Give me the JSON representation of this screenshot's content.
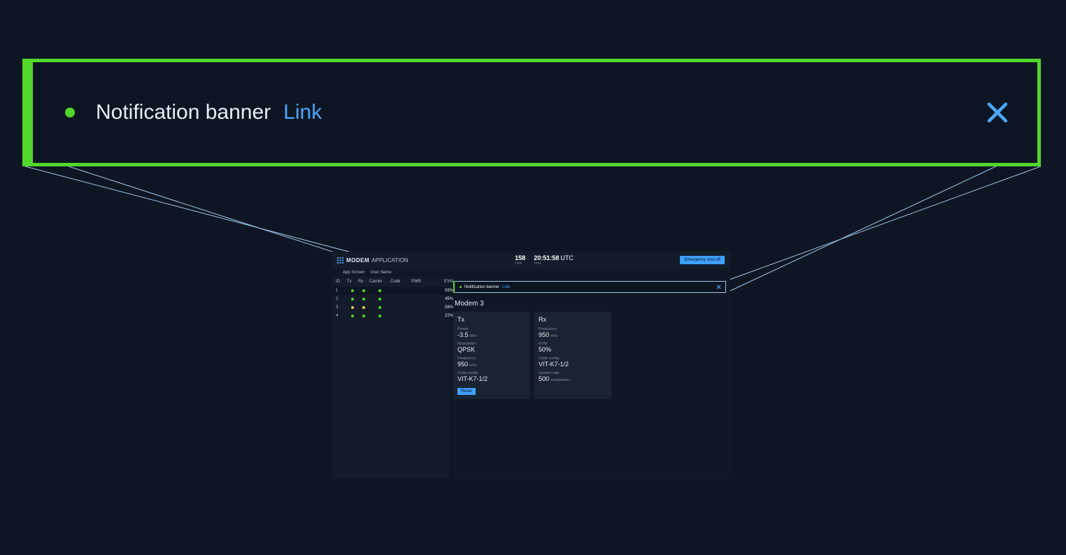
{
  "banner": {
    "text": "Notification banner",
    "link": "Link"
  },
  "app": {
    "title1": "MODEM",
    "title2": "APPLICATION",
    "sub1": "App Screen",
    "sub2": "User Name",
    "date_val": "158",
    "date_label": "Date",
    "time_val": "20:51:58",
    "tz": "UTC",
    "time_label": "Time",
    "emergency": "Emergency shut off"
  },
  "sidebar": {
    "headers": {
      "id": "ID",
      "tx": "Tx",
      "rx": "Rx",
      "carrier": "Carrier",
      "code": "Code",
      "pwr": "PWR",
      "evm": "EVM"
    },
    "rows": [
      {
        "id": "1",
        "tx": "g",
        "rx": "g",
        "carrier": "g",
        "evm": "56%"
      },
      {
        "id": "2",
        "tx": "g",
        "rx": "g",
        "carrier": "g",
        "evm": "45%"
      },
      {
        "id": "3",
        "tx": "y",
        "rx": "y",
        "carrier": "g",
        "evm": "58%"
      },
      {
        "id": "4",
        "tx": "g",
        "rx": "g",
        "carrier": "g",
        "evm": "22%"
      }
    ]
  },
  "detail": {
    "title": "Modem 3",
    "tx": {
      "title": "Tx",
      "power_lab": "Power",
      "power_val": "-3.5",
      "power_unit": "dBm",
      "mod_lab": "Modulation",
      "mod_val": "QPSK",
      "freq_lab": "Frequency",
      "freq_val": "950",
      "freq_unit": "mHz",
      "code_lab": "Code config",
      "code_val": "VIT-K7-1/2",
      "reset": "Reset"
    },
    "rx": {
      "title": "Rx",
      "freq_lab": "Frequency",
      "freq_val": "950",
      "freq_unit": "mHz",
      "evm_lab": "EVM",
      "evm_val": "50%",
      "code_lab": "Code config",
      "code_val": "VIT-K7-1/2",
      "sym_lab": "Symbol rate",
      "sym_val": "500",
      "sym_unit": "samples/sec"
    }
  }
}
